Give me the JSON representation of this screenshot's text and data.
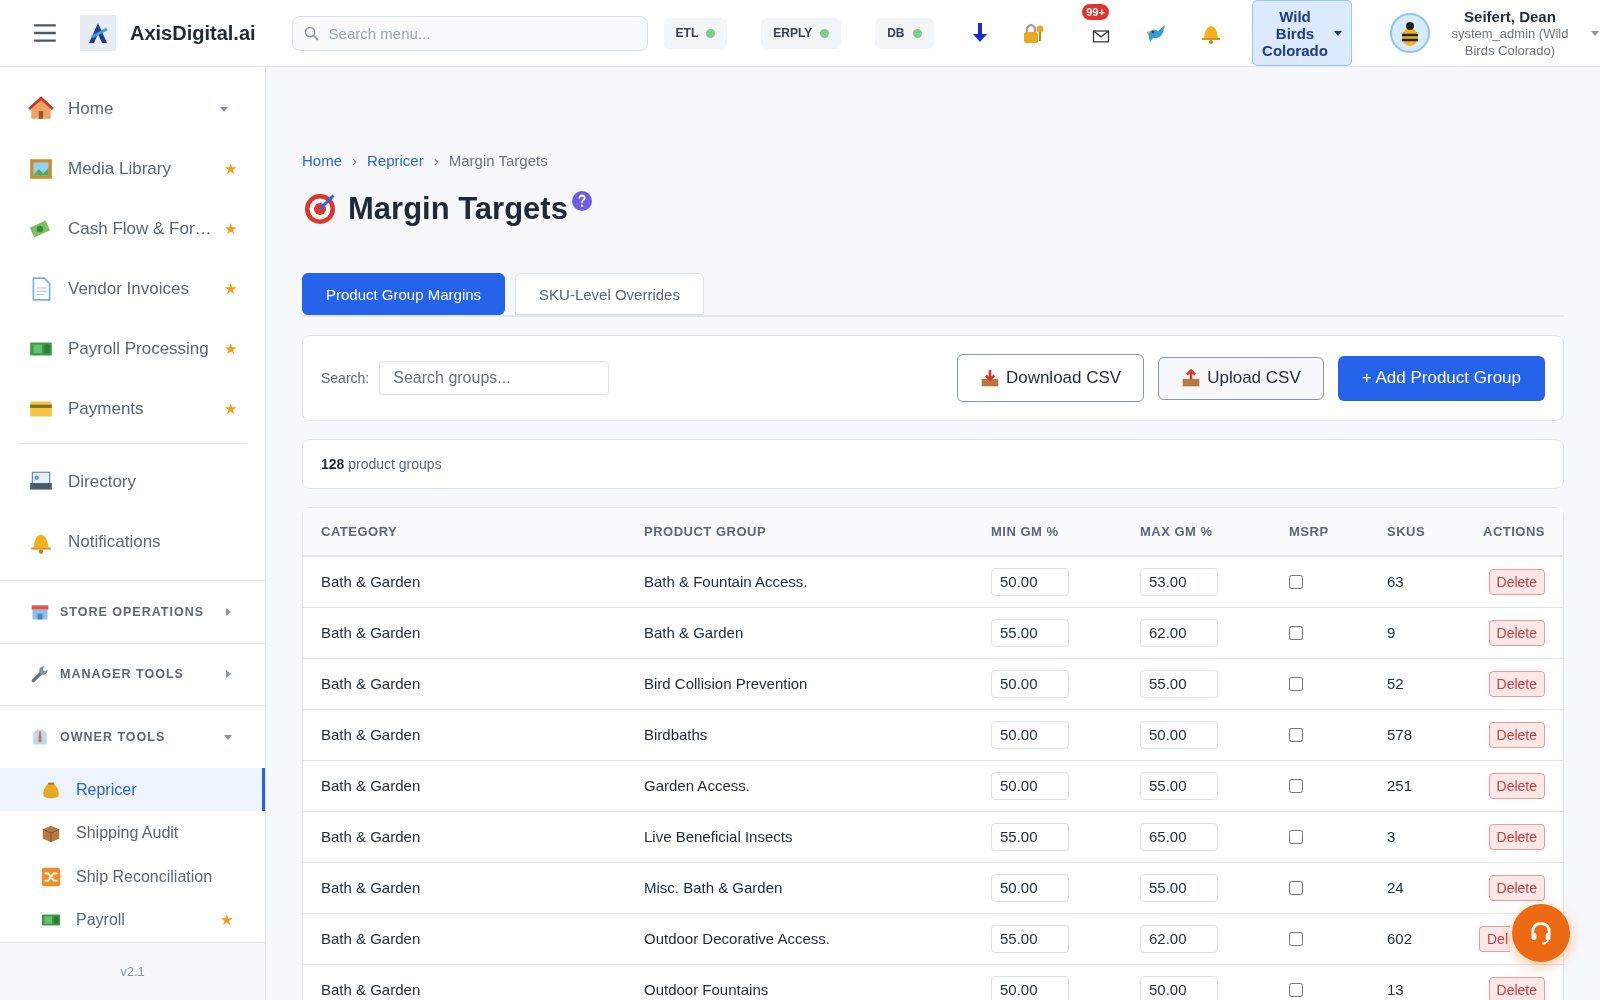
{
  "header": {
    "brand": "AxisDigital.ai",
    "search": {
      "placeholder": "Search menu..."
    },
    "status": [
      {
        "label": "ETL",
        "color": "#7ccf8a"
      },
      {
        "label": "ERPLY",
        "color": "#7ccf8a"
      },
      {
        "label": "DB",
        "color": "#7ccf8a"
      }
    ],
    "mail_badge": "99+",
    "store": "Wild Birds Colorado",
    "user": {
      "name": "Seifert, Dean",
      "role": "system_admin (Wild Birds Colorado)"
    }
  },
  "sidebar": {
    "items": [
      {
        "label": "Home",
        "kind": "group",
        "expanded": false
      },
      {
        "label": "Media Library",
        "kind": "link",
        "star": "★"
      },
      {
        "label": "Cash Flow & For…",
        "kind": "link",
        "star": "★"
      },
      {
        "label": "Vendor Invoices",
        "kind": "link",
        "star": "★"
      },
      {
        "label": "Payroll Processing",
        "kind": "link",
        "star": "★"
      },
      {
        "label": "Payments",
        "kind": "link",
        "star": "★"
      }
    ],
    "items_2": [
      {
        "label": "Directory",
        "kind": "link"
      },
      {
        "label": "Notifications",
        "kind": "link"
      }
    ],
    "sections": [
      {
        "label": "STORE OPERATIONS",
        "expanded": false
      },
      {
        "label": "MANAGER TOOLS",
        "expanded": false
      },
      {
        "label": "OWNER TOOLS",
        "expanded": true,
        "children": [
          {
            "label": "Repricer",
            "selected": true
          },
          {
            "label": "Shipping Audit",
            "selected": false
          },
          {
            "label": "Ship Reconciliation",
            "selected": false
          },
          {
            "label": "Payroll",
            "selected": false,
            "star": "★"
          }
        ]
      }
    ],
    "version": "v2.1"
  },
  "breadcrumb": [
    {
      "label": "Home",
      "kind": "link"
    },
    {
      "label": "›",
      "kind": "separator"
    },
    {
      "label": "Repricer",
      "kind": "link"
    },
    {
      "label": "›",
      "kind": "separator"
    },
    {
      "label": "Margin Targets",
      "kind": "current"
    }
  ],
  "title": "Margin Targets",
  "tabs": [
    {
      "label": "Product Group Margins",
      "selected": true
    },
    {
      "label": "SKU-Level Overrides",
      "selected": false
    }
  ],
  "toolbar": {
    "search_label": "Search:",
    "search_placeholder": "Search groups...",
    "buttons": [
      {
        "label": "Download CSV",
        "kind": "download"
      },
      {
        "label": "Upload CSV",
        "kind": "upload"
      },
      {
        "label": "+ Add Product Group",
        "kind": "primary"
      }
    ]
  },
  "summary": {
    "count": "128",
    "text": "product groups"
  },
  "table": {
    "columns": [
      "CATEGORY",
      "PRODUCT GROUP",
      "MIN GM %",
      "MAX GM %",
      "MSRP",
      "SKUS",
      "ACTIONS"
    ],
    "rows": [
      {
        "category": "Bath & Garden",
        "group": "Bath & Fountain Access.",
        "min": "50.00",
        "max": "53.00",
        "msrp": false,
        "skus": "63",
        "action": "Delete",
        "covered": false
      },
      {
        "category": "Bath & Garden",
        "group": "Bath & Garden",
        "min": "55.00",
        "max": "62.00",
        "msrp": false,
        "skus": "9",
        "action": "Delete",
        "covered": false
      },
      {
        "category": "Bath & Garden",
        "group": "Bird Collision Prevention",
        "min": "50.00",
        "max": "55.00",
        "msrp": false,
        "skus": "52",
        "action": "Delete",
        "covered": false
      },
      {
        "category": "Bath & Garden",
        "group": "Birdbaths",
        "min": "50.00",
        "max": "50.00",
        "msrp": false,
        "skus": "578",
        "action": "Delete",
        "covered": false
      },
      {
        "category": "Bath & Garden",
        "group": "Garden Access.",
        "min": "50.00",
        "max": "55.00",
        "msrp": false,
        "skus": "251",
        "action": "Delete",
        "covered": false
      },
      {
        "category": "Bath & Garden",
        "group": "Live Beneficial Insects",
        "min": "55.00",
        "max": "65.00",
        "msrp": false,
        "skus": "3",
        "action": "Delete",
        "covered": false
      },
      {
        "category": "Bath & Garden",
        "group": "Misc. Bath & Garden",
        "min": "50.00",
        "max": "55.00",
        "msrp": false,
        "skus": "24",
        "action": "Delete",
        "covered": false
      },
      {
        "category": "Bath & Garden",
        "group": "Outdoor Decorative Access.",
        "min": "55.00",
        "max": "62.00",
        "msrp": false,
        "skus": "602",
        "action": "Del",
        "covered": true
      },
      {
        "category": "Bath & Garden",
        "group": "Outdoor Fountains",
        "min": "50.00",
        "max": "50.00",
        "msrp": false,
        "skus": "13",
        "action": "Delete",
        "covered": false
      }
    ]
  }
}
